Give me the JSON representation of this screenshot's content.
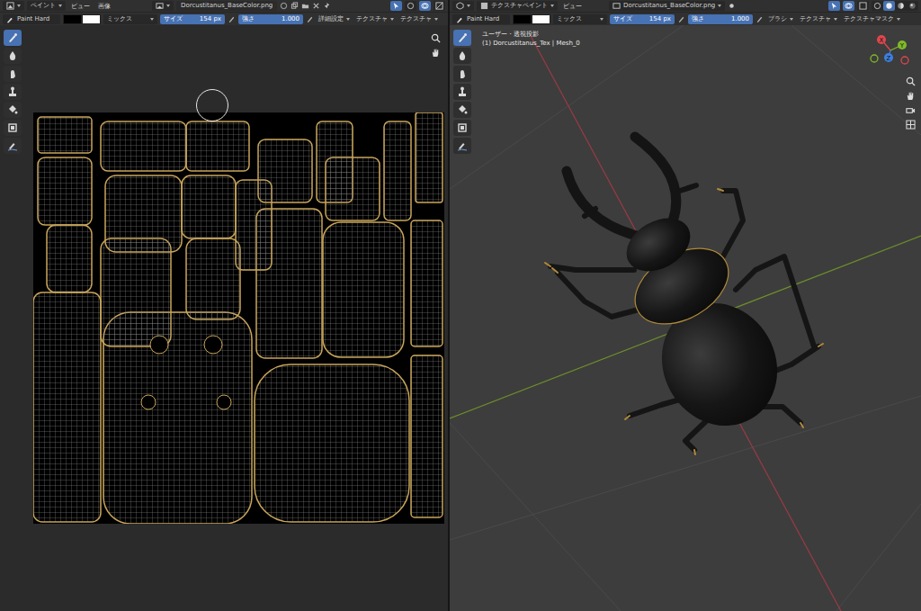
{
  "image_editor": {
    "header": {
      "mode": "ペイント",
      "menus": [
        "ビュー",
        "画像"
      ],
      "image": "Dorcustitanus_BaseColor.png"
    },
    "tool_settings": {
      "brush": "Paint Hard",
      "colors": [
        {
          "color": "#000000"
        },
        {
          "color": "#ffffff"
        }
      ],
      "blend": "ミックス",
      "size": {
        "label": "サイズ",
        "value": "154 px"
      },
      "strength": {
        "label": "強さ",
        "value": "1.000"
      },
      "popovers": [
        "詳細設定",
        "テクスチャ",
        "テクスチャ"
      ]
    },
    "tools": [
      {
        "kind": "draw",
        "selected": true
      },
      {
        "kind": "soften",
        "selected": false
      },
      {
        "kind": "smear",
        "selected": false
      },
      {
        "kind": "clone",
        "selected": false
      },
      {
        "kind": "fill",
        "selected": false
      },
      {
        "kind": "mask",
        "selected": false
      },
      {
        "kind": "annotate",
        "selected": false
      }
    ]
  },
  "viewport": {
    "header": {
      "mode": "テクスチャペイント",
      "menus": [
        "ビュー"
      ],
      "image": "Dorcustitanus_BaseColor.png"
    },
    "tool_settings": {
      "brush": "Paint Hard",
      "colors": [
        {
          "color": "#000000"
        },
        {
          "color": "#ffffff"
        }
      ],
      "blend": "ミックス",
      "size": {
        "label": "サイズ",
        "value": "154 px"
      },
      "strength": {
        "label": "強さ",
        "value": "1.000"
      },
      "popovers": [
        "ブラシ",
        "テクスチャ",
        "テクスチャマスク"
      ]
    },
    "tools": [
      {
        "kind": "draw",
        "selected": true
      },
      {
        "kind": "soften",
        "selected": false
      },
      {
        "kind": "smear",
        "selected": false
      },
      {
        "kind": "clone",
        "selected": false
      },
      {
        "kind": "fill",
        "selected": false
      },
      {
        "kind": "mask",
        "selected": false
      },
      {
        "kind": "annotate",
        "selected": false
      }
    ],
    "overlay": {
      "view": "ユーザー・透視投影",
      "object": "(1) Dorcustitanus_Tex | Mesh_0"
    },
    "gizmo": [
      {
        "label": "X",
        "color": "#e0474d"
      },
      {
        "label": "Y",
        "color": "#7fba2a"
      },
      {
        "label": "Z",
        "color": "#3d80e0"
      }
    ],
    "shading": [
      {
        "kind": "wireframe",
        "selected": false
      },
      {
        "kind": "solid",
        "selected": true
      },
      {
        "kind": "material",
        "selected": false
      },
      {
        "kind": "rendered",
        "selected": false
      }
    ]
  }
}
